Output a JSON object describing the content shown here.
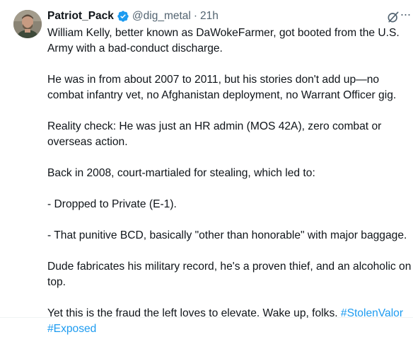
{
  "author": {
    "name": "Patriot_Pack",
    "handle": "@dig_metal",
    "separator": "·",
    "time": "21h",
    "verified": true,
    "verified_color": "#1d9bf0"
  },
  "icons": {
    "grok": "grok-icon",
    "more": "more-options-icon",
    "verified": "verified-badge-icon"
  },
  "tweet": {
    "p1": "William Kelly, better known as DaWokeFarmer, got booted from the U.S. Army with a bad-conduct discharge.",
    "p2": "He was in from about 2007 to 2011, but his stories don't add up—no combat infantry vet, no Afghanistan deployment, no Warrant Officer gig.",
    "p3": "Reality check: He was just an HR admin (MOS 42A), zero combat or overseas action.",
    "p4": "Back in 2008, court-martialed for stealing, which led to:",
    "p5": "- Dropped to Private (E-1).",
    "p6": "- That punitive BCD, basically \"other than honorable\" with major baggage.",
    "p7": "Dude fabricates his military record, he's a proven thief, and an alcoholic on top.",
    "p8_text": "Yet this is the fraud the left loves to elevate. Wake up, folks. ",
    "hashtag1": "#StolenValor",
    "hashtag2": "#Exposed"
  },
  "colors": {
    "text": "#0f1419",
    "secondary": "#536471",
    "link": "#1d9bf0"
  }
}
